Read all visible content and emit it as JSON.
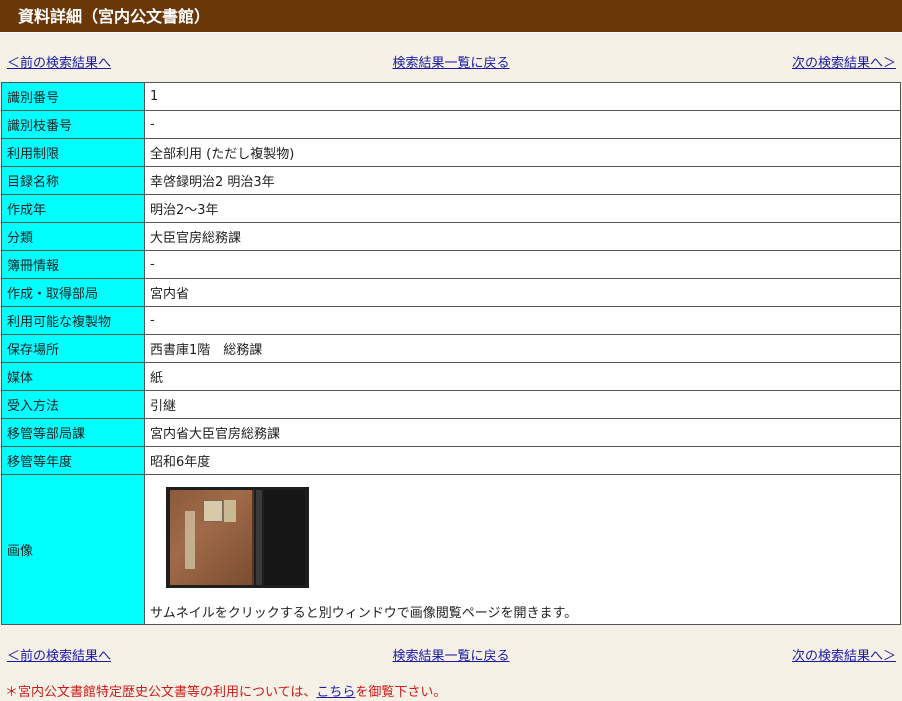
{
  "page": {
    "title": "資料詳細（宮内公文書館）"
  },
  "nav": {
    "prev": "＜前の検索結果へ",
    "list": "検索結果一覧に戻る",
    "next": "次の検索結果へ＞"
  },
  "details": [
    {
      "label": "識別番号",
      "value": "1"
    },
    {
      "label": "識別枝番号",
      "value": "-"
    },
    {
      "label": "利用制限",
      "value": "全部利用 (ただし複製物)"
    },
    {
      "label": "目録名称",
      "value": "幸啓録明治2 明治3年"
    },
    {
      "label": "作成年",
      "value": "明治2～3年"
    },
    {
      "label": "分類",
      "value": "大臣官房総務課"
    },
    {
      "label": "簿冊情報",
      "value": "-"
    },
    {
      "label": "作成・取得部局",
      "value": "宮内省"
    },
    {
      "label": "利用可能な複製物",
      "value": "-"
    },
    {
      "label": "保存場所",
      "value": "西書庫1階　総務課"
    },
    {
      "label": "媒体",
      "value": "紙"
    },
    {
      "label": "受入方法",
      "value": "引継"
    },
    {
      "label": "移管等部局課",
      "value": "宮内省大臣官房総務課"
    },
    {
      "label": "移管等年度",
      "value": "昭和6年度"
    }
  ],
  "image": {
    "label": "画像",
    "caption": "サムネイルをクリックすると別ウィンドウで画像閲覧ページを開きます。"
  },
  "footer": {
    "prefix": "＊宮内公文書館特定歴史公文書等の利用については、",
    "link": "こちら",
    "suffix": "を御覧下さい。"
  }
}
